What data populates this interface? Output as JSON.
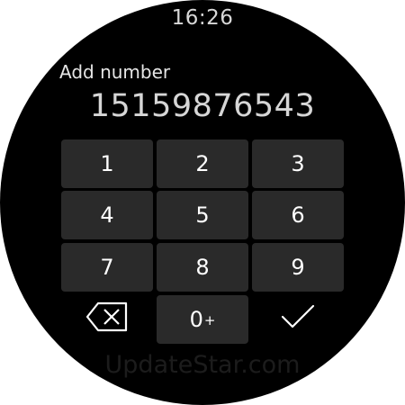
{
  "status": {
    "time": "16:26"
  },
  "header": {
    "title": "Add number"
  },
  "entry": {
    "number": "15159876543"
  },
  "keypad": {
    "keys": [
      "1",
      "2",
      "3",
      "4",
      "5",
      "6",
      "7",
      "8",
      "9"
    ],
    "zero_label": "0",
    "zero_secondary": "+",
    "backspace_icon": "backspace-icon",
    "confirm_icon": "checkmark-icon"
  },
  "watermark": {
    "text": "UpdateStar.com"
  }
}
